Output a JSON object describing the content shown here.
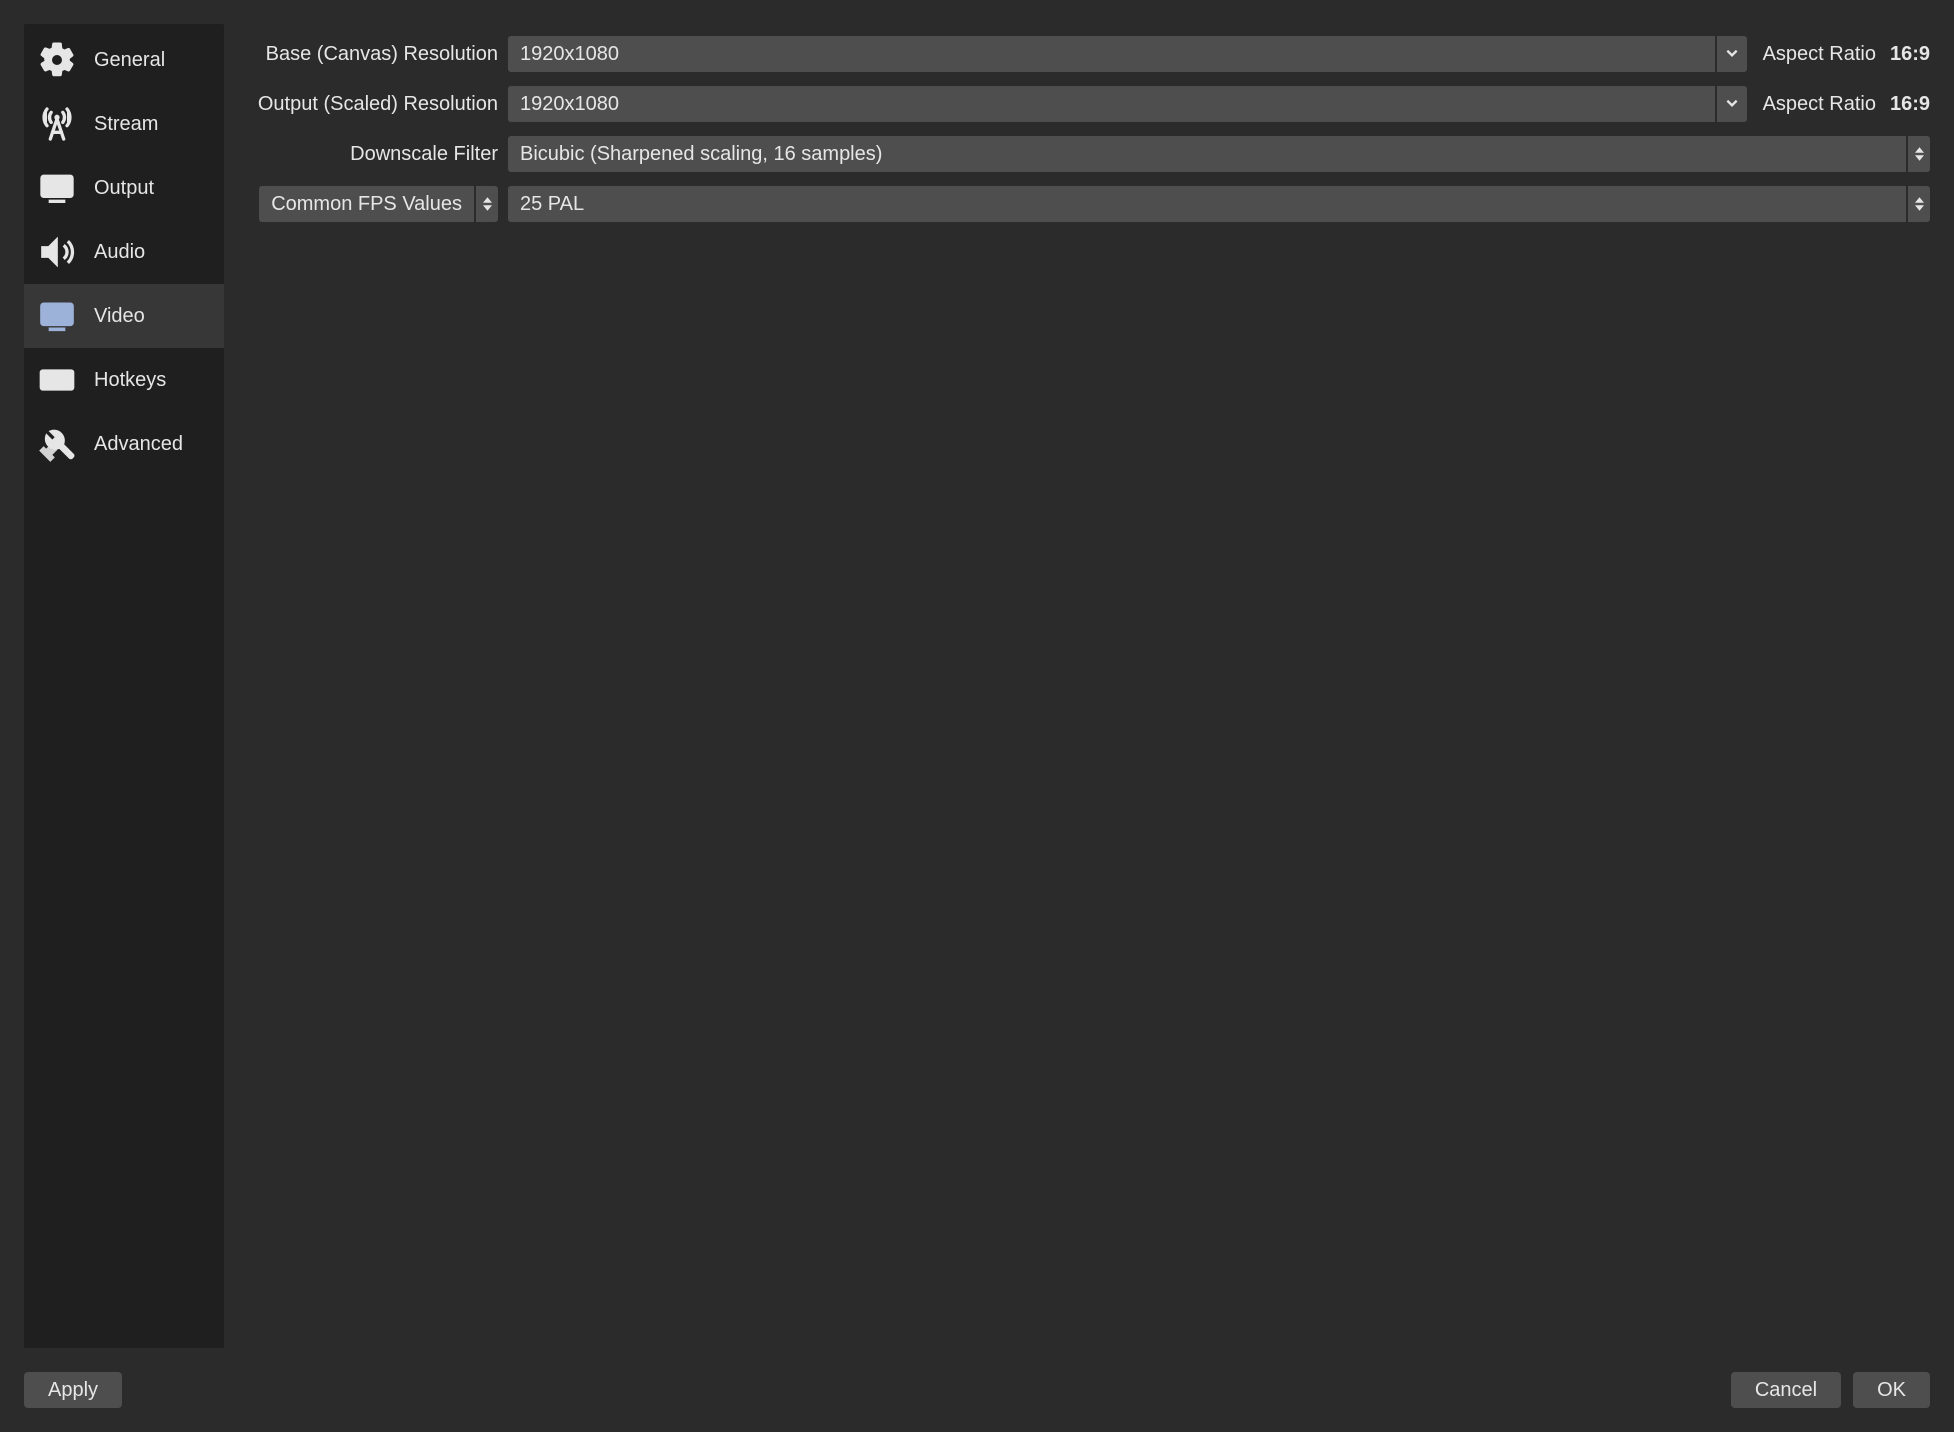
{
  "sidebar": {
    "items": [
      {
        "id": "general",
        "label": "General"
      },
      {
        "id": "stream",
        "label": "Stream"
      },
      {
        "id": "output",
        "label": "Output"
      },
      {
        "id": "audio",
        "label": "Audio"
      },
      {
        "id": "video",
        "label": "Video"
      },
      {
        "id": "hotkeys",
        "label": "Hotkeys"
      },
      {
        "id": "advanced",
        "label": "Advanced"
      }
    ],
    "active": "video"
  },
  "video": {
    "base_label": "Base (Canvas) Resolution",
    "base_value": "1920x1080",
    "base_aspect_label": "Aspect Ratio",
    "base_aspect_value": "16:9",
    "output_label": "Output (Scaled) Resolution",
    "output_value": "1920x1080",
    "output_aspect_label": "Aspect Ratio",
    "output_aspect_value": "16:9",
    "downscale_label": "Downscale Filter",
    "downscale_value": "Bicubic (Sharpened scaling, 16 samples)",
    "fps_mode_label": "Common FPS Values",
    "fps_value": "25 PAL"
  },
  "footer": {
    "apply": "Apply",
    "cancel": "Cancel",
    "ok": "OK"
  }
}
